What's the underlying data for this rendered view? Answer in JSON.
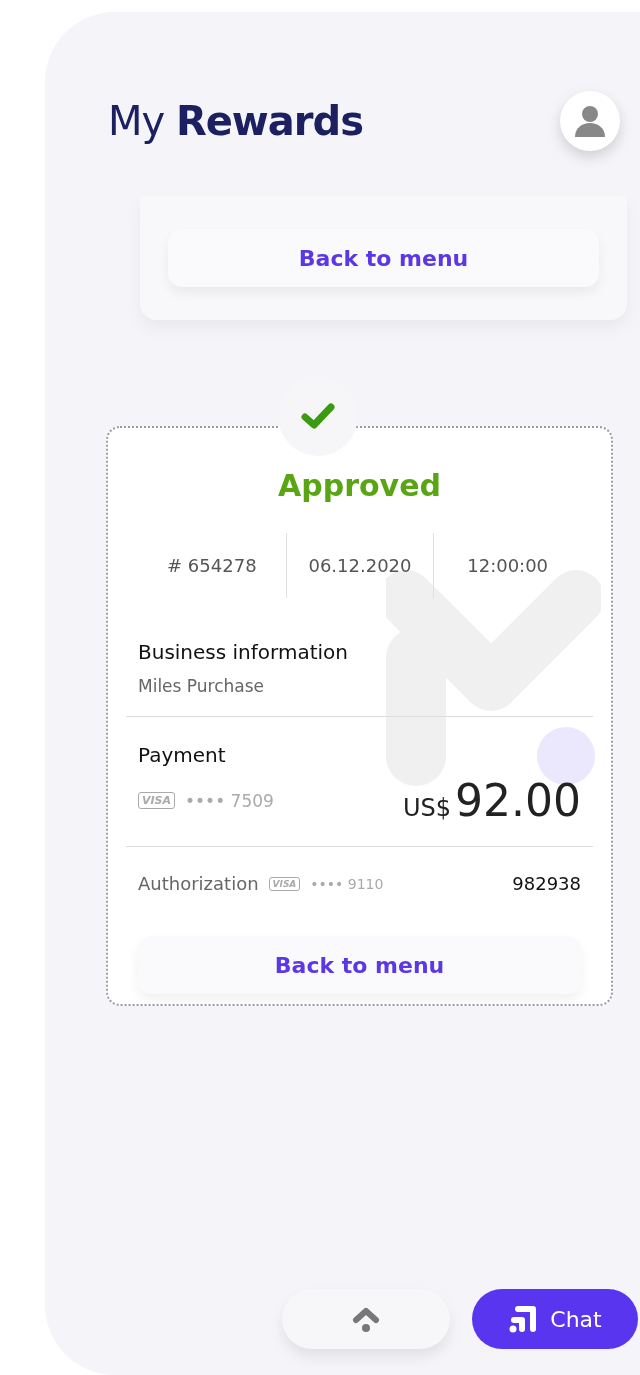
{
  "header": {
    "title_light": "My",
    "title_bold": "Rewards"
  },
  "top_card": {
    "button": "Back to menu"
  },
  "receipt": {
    "status": "Approved",
    "meta": [
      "# 654278",
      "06.12.2020",
      "12:00:00"
    ],
    "business": {
      "heading": "Business information",
      "value": "Miles Purchase"
    },
    "payment": {
      "heading": "Payment",
      "brand": "VISA",
      "card": "•••• 7509",
      "currency": "US$",
      "amount": "92.00"
    },
    "authorization": {
      "label": "Authorization",
      "brand": "VISA",
      "card": "•••• 9110",
      "code": "982938"
    },
    "button": "Back to menu"
  },
  "bottom": {
    "chat": "Chat"
  }
}
